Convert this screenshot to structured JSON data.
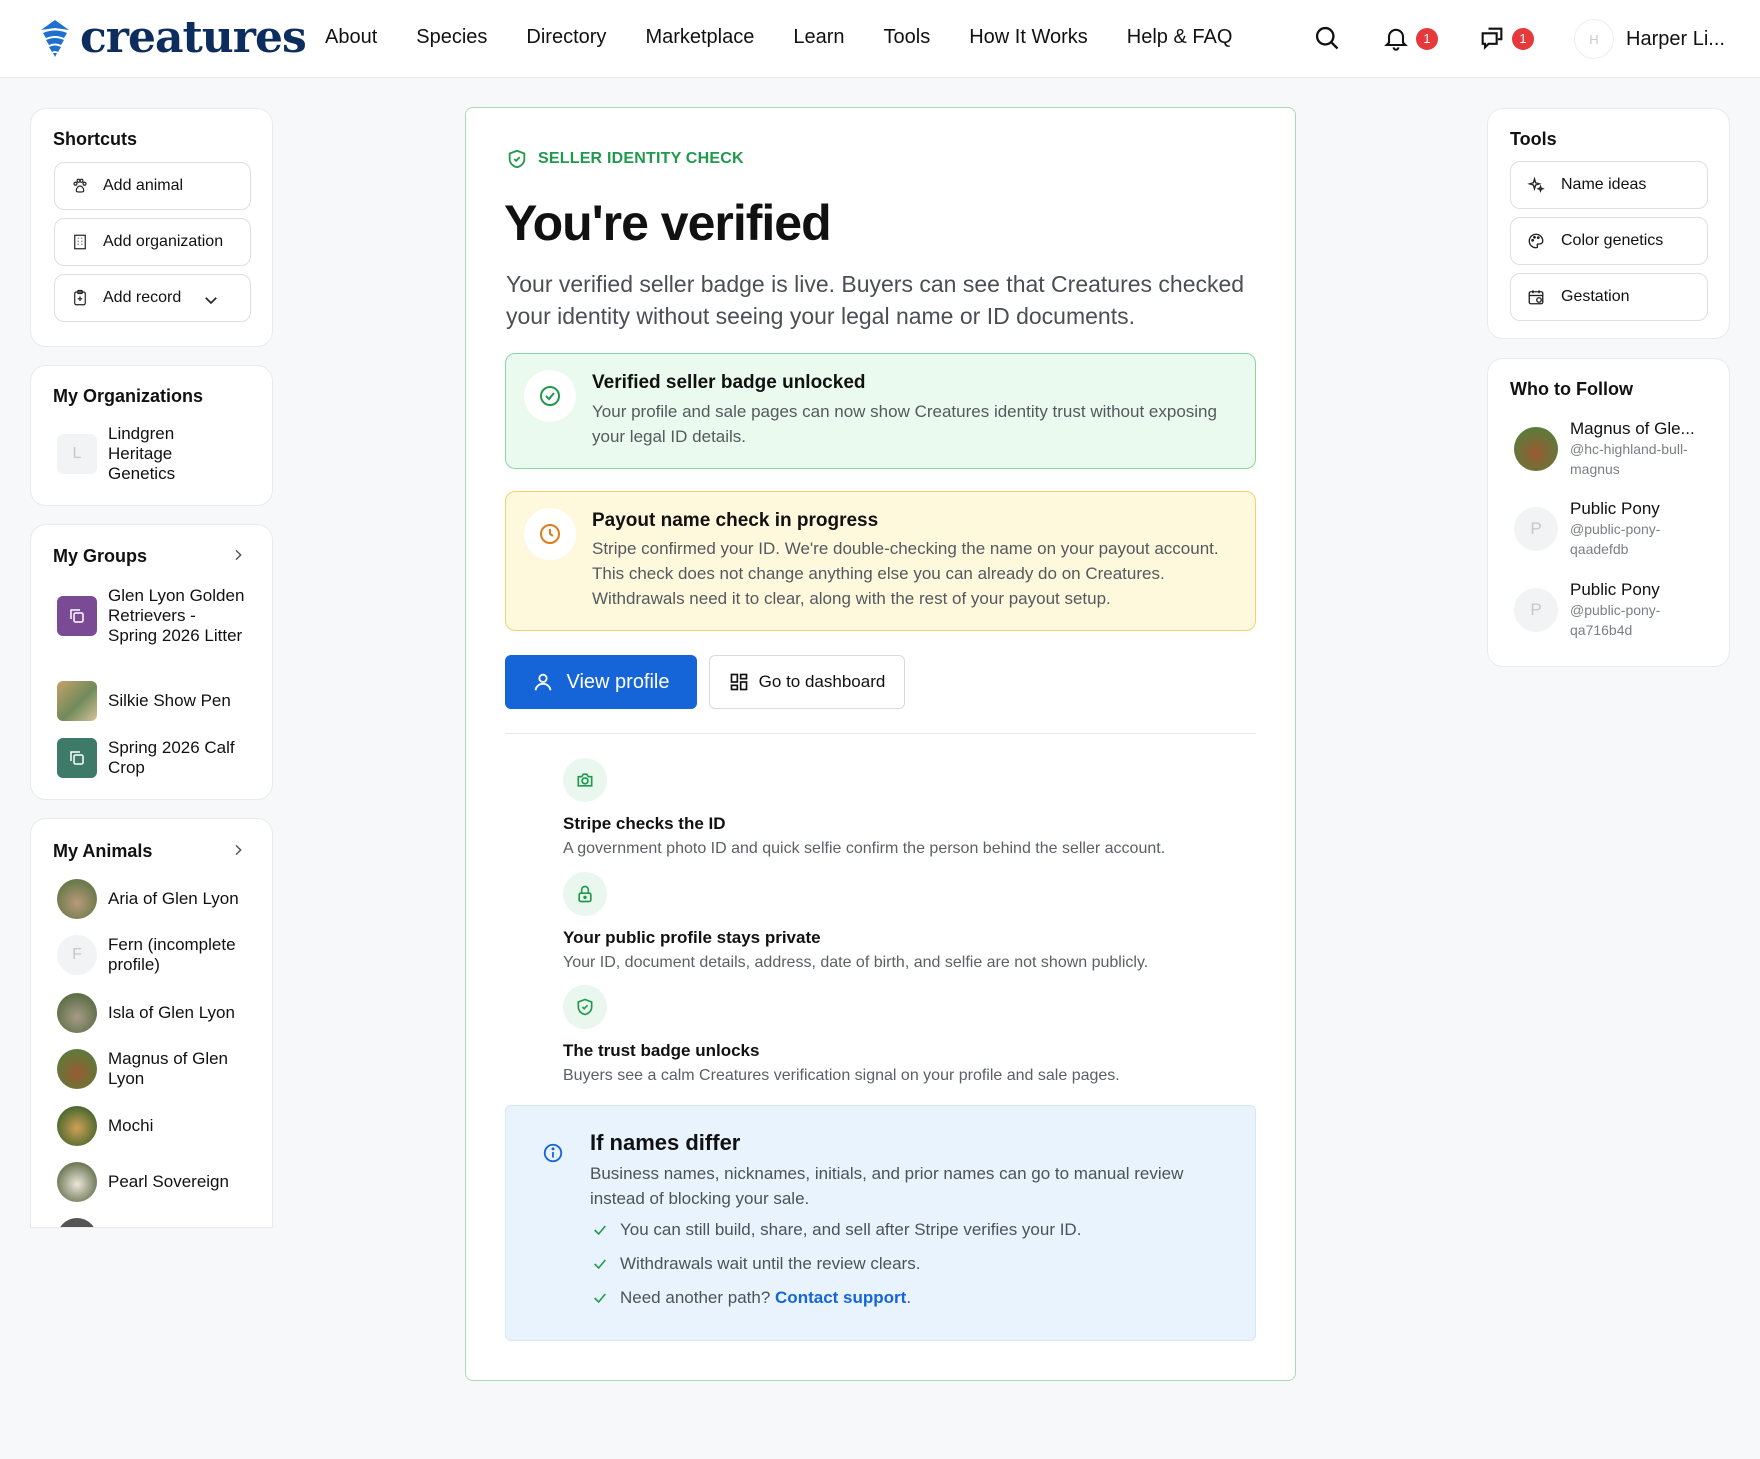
{
  "brand": {
    "name": "creatures"
  },
  "nav": {
    "links": [
      "About",
      "Species",
      "Directory",
      "Marketplace",
      "Learn",
      "Tools",
      "How It Works",
      "Help & FAQ"
    ],
    "notifications_count": "1",
    "messages_count": "1",
    "user_initial": "H",
    "user_name": "Harper Li..."
  },
  "shortcuts": {
    "title": "Shortcuts",
    "items": [
      {
        "label": "Add animal",
        "icon": "paw-icon"
      },
      {
        "label": "Add organization",
        "icon": "building-icon"
      },
      {
        "label": "Add record",
        "icon": "clipboard-icon"
      }
    ]
  },
  "organizations": {
    "title": "My Organizations",
    "items": [
      {
        "initial": "L",
        "name": "Lindgren Heritage Genetics"
      }
    ]
  },
  "groups": {
    "title": "My Groups",
    "items": [
      {
        "name": "Glen Lyon Golden Retrievers - Spring 2026 Litter",
        "color": "#7a4a95"
      },
      {
        "name": "Silkie Show Pen",
        "color": "#8a9d6a"
      },
      {
        "name": "Spring 2026 Calf Crop",
        "color": "#3d7a68"
      }
    ]
  },
  "animals": {
    "title": "My Animals",
    "items": [
      {
        "name": "Aria of Glen Lyon"
      },
      {
        "name": "Fern (incomplete profile)",
        "initial": "F"
      },
      {
        "name": "Isla of Glen Lyon"
      },
      {
        "name": "Magnus of Glen Lyon"
      },
      {
        "name": "Mochi"
      },
      {
        "name": "Pearl Sovereign"
      }
    ]
  },
  "main": {
    "kicker": "SELLER IDENTITY CHECK",
    "title": "You're verified",
    "lead": "Your verified seller badge is live. Buyers can see that Creatures checked your identity without seeing your legal name or ID documents.",
    "success": {
      "title": "Verified seller badge unlocked",
      "body": "Your profile and sale pages can now show Creatures identity trust without exposing your legal ID details."
    },
    "pending": {
      "title": "Payout name check in progress",
      "body": "Stripe confirmed your ID. We're double-checking the name on your payout account. This check does not change anything else you can already do on Creatures. Withdrawals need it to clear, along with the rest of your payout setup."
    },
    "view_profile_label": "View profile",
    "dashboard_label": "Go to dashboard",
    "steps": [
      {
        "title": "Stripe checks the ID",
        "body": "A government photo ID and quick selfie confirm the person behind the seller account.",
        "icon": "camera-icon"
      },
      {
        "title": "Your public profile stays private",
        "body": "Your ID, document details, address, date of birth, and selfie are not shown publicly.",
        "icon": "lock-icon"
      },
      {
        "title": "The trust badge unlocks",
        "body": "Buyers see a calm Creatures verification signal on your profile and sale pages.",
        "icon": "shield-icon"
      }
    ],
    "info": {
      "title": "If names differ",
      "body": "Business names, nicknames, initials, and prior names can go to manual review instead of blocking your sale.",
      "checks": [
        "You can still build, share, and sell after Stripe verifies your ID.",
        "Withdrawals wait until the review clears."
      ],
      "support_prefix": "Need another path?",
      "support_link": "Contact support",
      "support_suffix": "."
    }
  },
  "tools": {
    "title": "Tools",
    "items": [
      {
        "label": "Name ideas",
        "icon": "sparkle-icon"
      },
      {
        "label": "Color genetics",
        "icon": "palette-icon"
      },
      {
        "label": "Gestation",
        "icon": "calendar-icon"
      }
    ]
  },
  "follow": {
    "title": "Who to Follow",
    "items": [
      {
        "name": "Magnus of Gle...",
        "handle": "@hc-highland-bull-magnus"
      },
      {
        "name": "Public Pony",
        "handle": "@public-pony-qaadefdb",
        "initial": "P"
      },
      {
        "name": "Public Pony",
        "handle": "@public-pony-qa716b4d",
        "initial": "P"
      }
    ]
  },
  "colors": {
    "accent": "#1565d8",
    "success": "#1f9a4c",
    "warning": "#e07b17",
    "badge": "#e5393b"
  }
}
